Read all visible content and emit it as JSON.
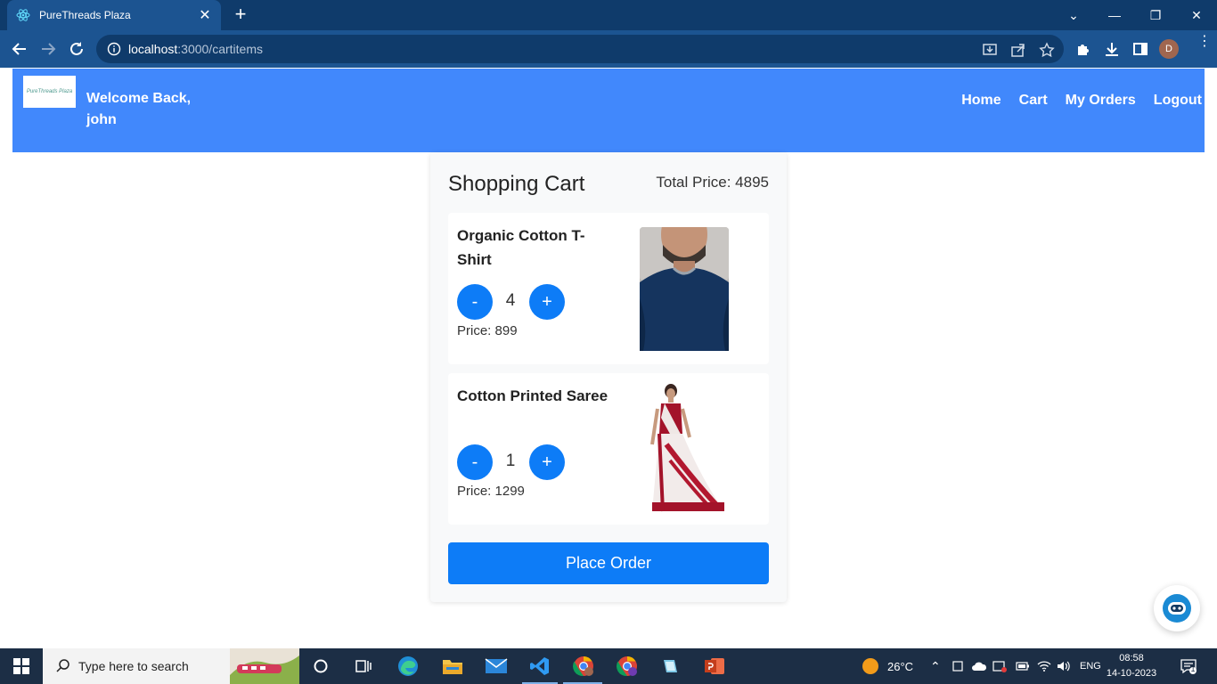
{
  "browser": {
    "tab_title": "PureThreads Plaza",
    "url_host": "localhost",
    "url_path": ":3000/cartitems",
    "profile_initial": "D"
  },
  "header": {
    "logo_text": "PureThreads Plaza",
    "welcome": "Welcome Back,",
    "username": "john",
    "nav": [
      "Home",
      "Cart",
      "My Orders",
      "Logout"
    ]
  },
  "cart": {
    "title": "Shopping Cart",
    "total_price": "Total Price: 4895",
    "items": [
      {
        "name": "Organic Cotton T-Shirt",
        "quantity": "4",
        "price": "Price: 899",
        "minus": "-",
        "plus": "+"
      },
      {
        "name": "Cotton Printed Saree",
        "quantity": "1",
        "price": "Price: 1299",
        "minus": "-",
        "plus": "+"
      }
    ],
    "place_order": "Place Order"
  },
  "taskbar": {
    "search_placeholder": "Type here to search",
    "weather": "26°C",
    "language": "ENG",
    "time": "08:58",
    "date": "14-10-2023",
    "notification_count": "1"
  },
  "colors": {
    "header_blue": "#4188fc",
    "button_blue": "#0d7cf7",
    "browser_dark": "#0f3b6b",
    "browser_mid": "#1c5491"
  }
}
